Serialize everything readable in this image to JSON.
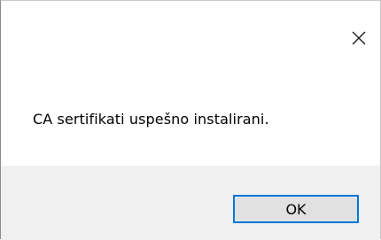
{
  "dialog": {
    "close_icon": "close-icon",
    "message": "CA sertifikati uspešno instalirani.",
    "ok_label": "OK"
  },
  "colors": {
    "footer_bg": "#f0f0f0",
    "button_bg": "#e1e1e1",
    "button_focus_border": "#0078d7"
  }
}
